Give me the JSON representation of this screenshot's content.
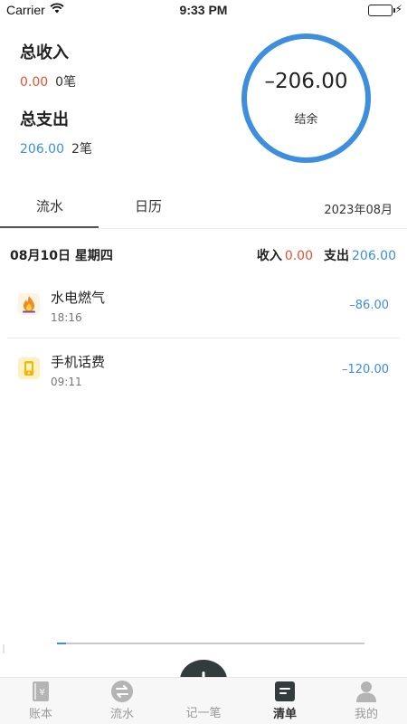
{
  "status_bar": {
    "carrier": "Carrier",
    "time": "9:33 PM",
    "battery_level": 1.0
  },
  "summary": {
    "income_label": "总收入",
    "income_amount": "0.00",
    "income_count": "0笔",
    "expense_label": "总支出",
    "expense_amount": "206.00",
    "expense_count": "2笔",
    "balance": "–206.00",
    "balance_label": "结余"
  },
  "tabs": {
    "flow": "流水",
    "calendar": "日历",
    "month": "2023年08月"
  },
  "day": {
    "date": "08月10日  星期四",
    "income_key": "收入",
    "income_value": "0.00",
    "expense_key": "支出",
    "expense_value": "206.00"
  },
  "records": [
    {
      "name": "水电燃气",
      "time": "18:16",
      "amount": "–86.00",
      "icon": "flame-icon"
    },
    {
      "name": "手机话费",
      "time": "09:11",
      "amount": "–120.00",
      "icon": "phone-icon"
    }
  ],
  "progress": {
    "fraction": 0.03
  },
  "tabbar": {
    "ledger": "账本",
    "flow": "流水",
    "add": "记一笔",
    "list": "清单",
    "mine": "我的",
    "active": "list"
  },
  "colors": {
    "accent": "#3d8edc",
    "income": "#e05232",
    "fab": "#333c3c"
  }
}
